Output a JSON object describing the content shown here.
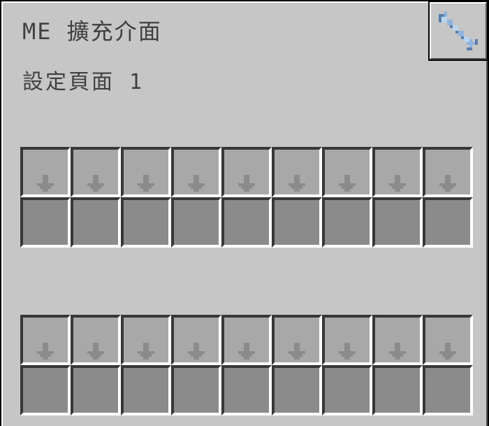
{
  "window": {
    "title": "ME 擴充介面",
    "page_label": "設定頁面 1"
  },
  "toolbar": {
    "wrench_icon": "wrench-icon"
  },
  "slot_groups": [
    {
      "config_slots": 9,
      "storage_slots": 9
    },
    {
      "config_slots": 9,
      "storage_slots": 9
    }
  ],
  "colors": {
    "background": "#c6c6c6",
    "text": "#404040",
    "config_slot": "#a8a8a8",
    "storage_slot": "#8b8b8b",
    "arrow": "#8b8b8b",
    "wrench": "#8fb4dc"
  }
}
